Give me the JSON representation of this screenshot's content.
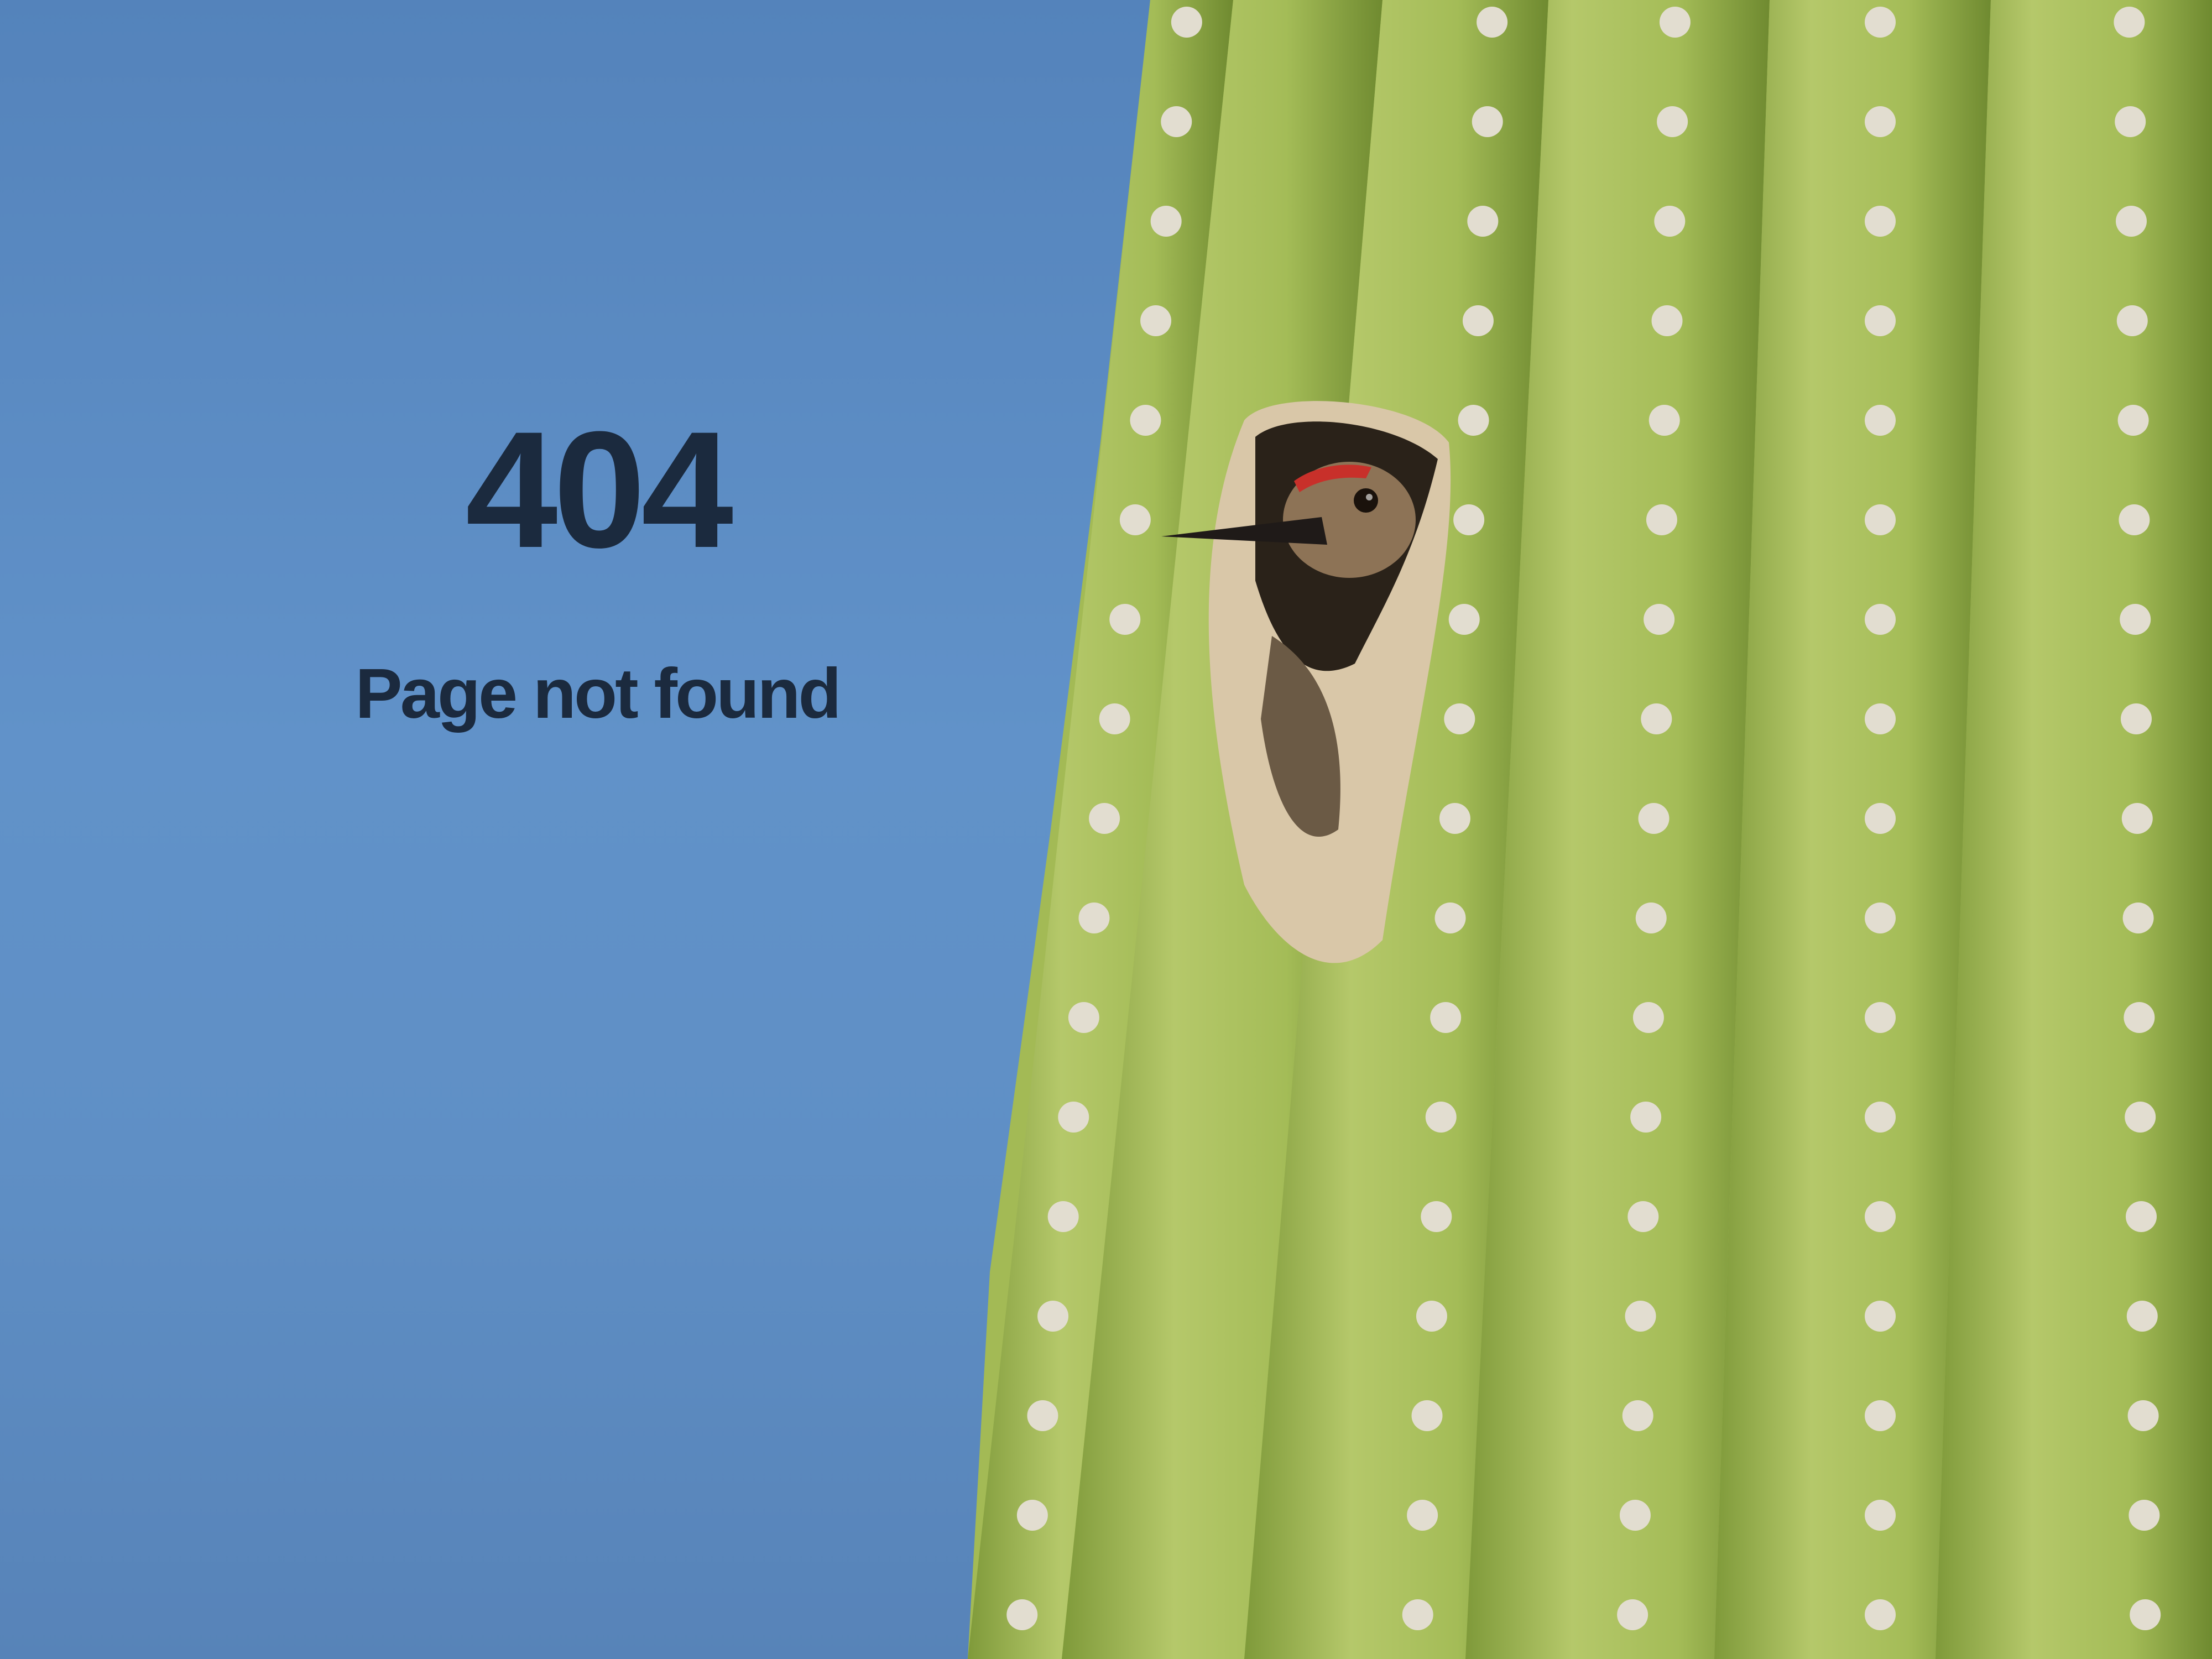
{
  "error": {
    "code": "404",
    "message": "Page not found"
  },
  "colors": {
    "sky": "#5f8fc5",
    "text": "#1b2a3e",
    "cactus": "#a8bf5a",
    "cactus_shadow": "#7f9a3a"
  }
}
